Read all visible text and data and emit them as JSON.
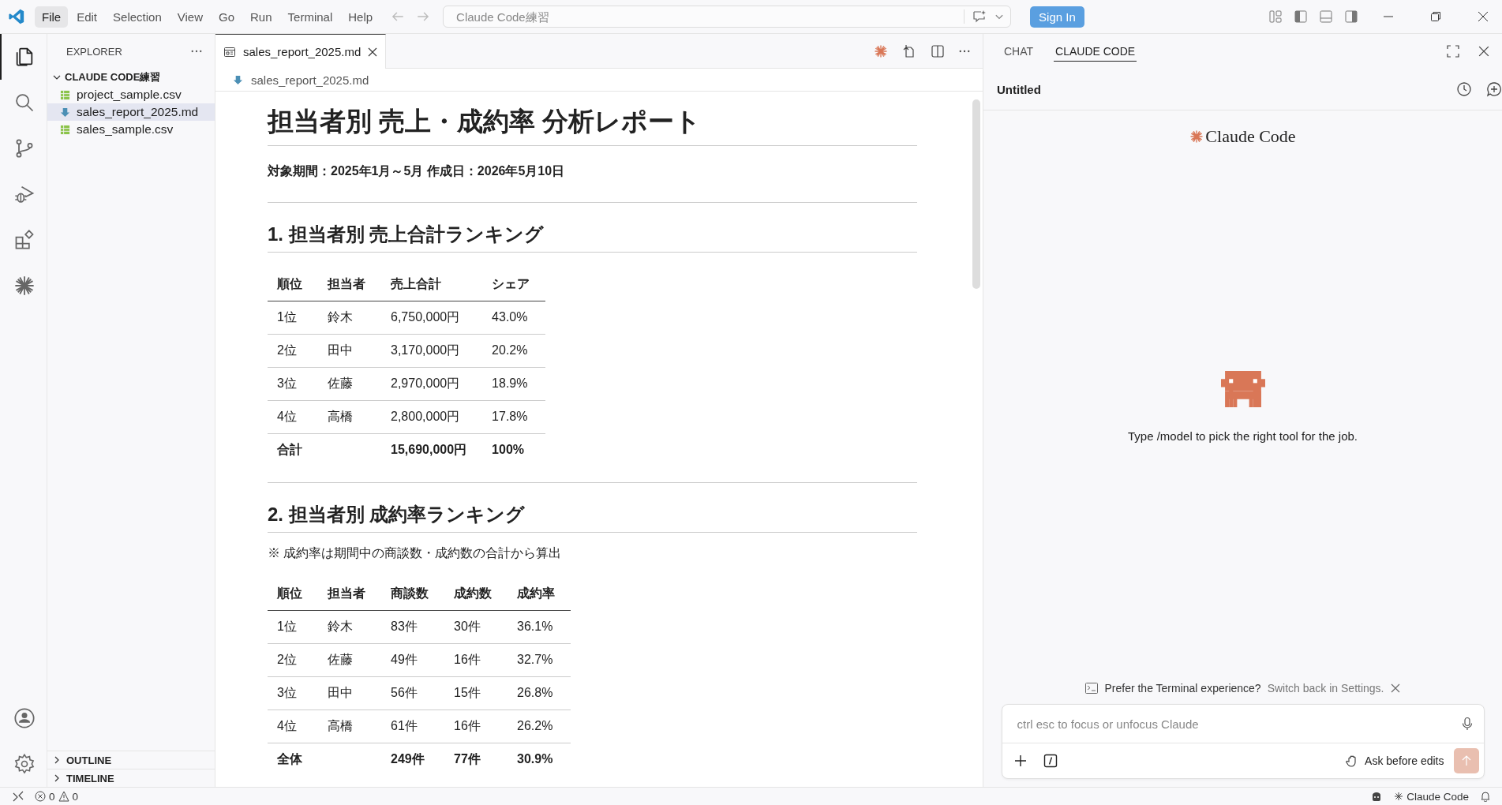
{
  "title_bar": {
    "menu": [
      {
        "label": "File",
        "selected": true
      },
      {
        "label": "Edit",
        "selected": false
      },
      {
        "label": "Selection",
        "selected": false
      },
      {
        "label": "View",
        "selected": false
      },
      {
        "label": "Go",
        "selected": false
      },
      {
        "label": "Run",
        "selected": false
      },
      {
        "label": "Terminal",
        "selected": false
      },
      {
        "label": "Help",
        "selected": false
      }
    ],
    "command_center": {
      "placeholder": "Claude Code練習"
    },
    "sign_in": "Sign In"
  },
  "activity_bar": {
    "top": [
      {
        "kind": "files",
        "selected": true
      },
      {
        "kind": "search",
        "selected": false
      },
      {
        "kind": "source-control",
        "selected": false
      },
      {
        "kind": "debug",
        "selected": false
      },
      {
        "kind": "extensions",
        "selected": false
      },
      {
        "kind": "claude",
        "selected": false
      }
    ],
    "bottom": [
      {
        "kind": "account",
        "selected": false
      },
      {
        "kind": "settings",
        "selected": false
      }
    ]
  },
  "sidebar": {
    "title": "EXPLORER",
    "folder": {
      "name": "CLAUDE CODE練習",
      "expanded": true,
      "children": [
        {
          "name": "project_sample.csv",
          "kind": "csv",
          "selected": false
        },
        {
          "name": "sales_report_2025.md",
          "kind": "md",
          "selected": true
        },
        {
          "name": "sales_sample.csv",
          "kind": "csv",
          "selected": false
        }
      ]
    },
    "sections": [
      {
        "label": "OUTLINE",
        "expanded": false
      },
      {
        "label": "TIMELINE",
        "expanded": false
      }
    ]
  },
  "editor": {
    "tabs": [
      {
        "label": "sales_report_2025.md",
        "selected": true
      }
    ],
    "breadcrumb": "sales_report_2025.md",
    "document": {
      "title": "担当者別 売上・成約率 分析レポート",
      "meta": "対象期間：2025年1月～5月 作成日：2026年5月10日",
      "sections": [
        {
          "heading": "1. 担当者別 売上合計ランキング",
          "table": {
            "columns": [
              "順位",
              "担当者",
              "売上合計",
              "シェア"
            ],
            "rows": [
              [
                "1位",
                "鈴木",
                "6,750,000円",
                "43.0%"
              ],
              [
                "2位",
                "田中",
                "3,170,000円",
                "20.2%"
              ],
              [
                "3位",
                "佐藤",
                "2,970,000円",
                "18.9%"
              ],
              [
                "4位",
                "高橋",
                "2,800,000円",
                "17.8%"
              ]
            ],
            "total": {
              "label": "合計",
              "cells": [
                "15,690,000円",
                "100%"
              ]
            }
          }
        },
        {
          "heading": "2. 担当者別 成約率ランキング",
          "note": "※ 成約率は期間中の商談数・成約数の合計から算出",
          "table": {
            "columns": [
              "順位",
              "担当者",
              "商談数",
              "成約数",
              "成約率"
            ],
            "rows": [
              [
                "1位",
                "鈴木",
                "83件",
                "30件",
                "36.1%"
              ],
              [
                "2位",
                "佐藤",
                "49件",
                "16件",
                "32.7%"
              ],
              [
                "3位",
                "田中",
                "56件",
                "15件",
                "26.8%"
              ],
              [
                "4位",
                "高橋",
                "61件",
                "16件",
                "26.2%"
              ]
            ],
            "total": {
              "label": "全体",
              "cells": [
                "249件",
                "77件",
                "30.9%"
              ]
            }
          }
        }
      ]
    }
  },
  "claude_panel": {
    "tabs": [
      {
        "label": "CHAT",
        "selected": false
      },
      {
        "label": "CLAUDE CODE",
        "selected": true
      }
    ],
    "session_title": "Untitled",
    "logo": "Claude Code",
    "hint": "Type /model to pick the right tool for the job.",
    "notice": {
      "text": "Prefer the Terminal experience?",
      "link": "Switch back in Settings."
    },
    "input": {
      "placeholder": "ctrl esc to focus or unfocus Claude"
    },
    "mode": "Ask before edits",
    "send_button": {
      "disabled": true
    }
  },
  "status_bar": {
    "errors": "0",
    "warnings": "0",
    "claude": "Claude Code"
  }
}
